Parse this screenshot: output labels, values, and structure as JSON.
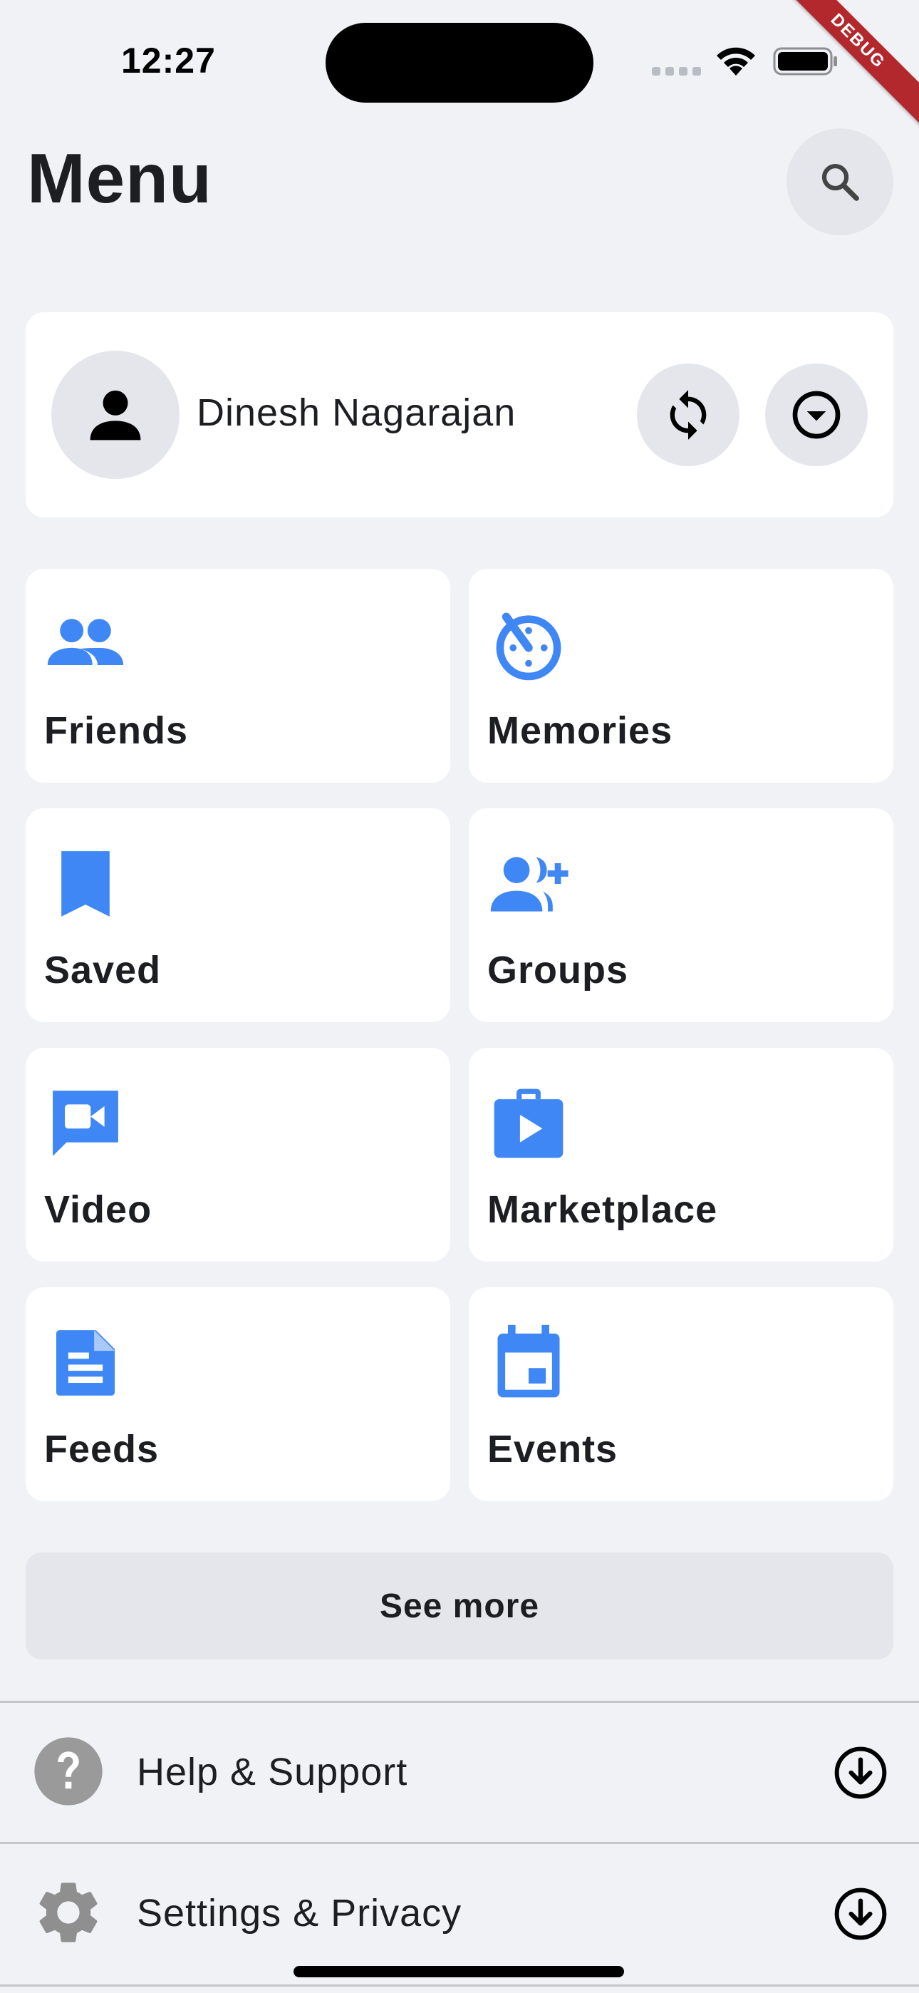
{
  "status_bar": {
    "time": "12:27",
    "icons": [
      "signal-icon",
      "wifi-icon",
      "battery-icon"
    ]
  },
  "debug_banner": "DEBUG",
  "header": {
    "title": "Menu",
    "search_icon": "search-icon"
  },
  "profile": {
    "name": "Dinesh Nagarajan",
    "avatar_icon": "person-icon",
    "actions": [
      "sync-icon",
      "chevron-down-circle-icon"
    ]
  },
  "shortcuts": [
    {
      "label": "Friends",
      "icon": "friends-icon"
    },
    {
      "label": "Memories",
      "icon": "memories-icon"
    },
    {
      "label": "Saved",
      "icon": "bookmark-icon"
    },
    {
      "label": "Groups",
      "icon": "group-add-icon"
    },
    {
      "label": "Video",
      "icon": "video-chat-icon"
    },
    {
      "label": "Marketplace",
      "icon": "marketplace-bag-icon"
    },
    {
      "label": "Feeds",
      "icon": "article-icon"
    },
    {
      "label": "Events",
      "icon": "calendar-icon"
    }
  ],
  "see_more_label": "See more",
  "sections": [
    {
      "label": "Help & Support",
      "icon": "help-icon"
    },
    {
      "label": "Settings & Privacy",
      "icon": "gear-icon"
    }
  ],
  "colors": {
    "background": "#f0f2f5",
    "card": "#ffffff",
    "accent_blue": "#3f87f5",
    "button_grey": "#e4e6eb",
    "text": "#1c1e21",
    "icon_grey": "#9a9a9a",
    "debug_red": "#b3282d"
  }
}
